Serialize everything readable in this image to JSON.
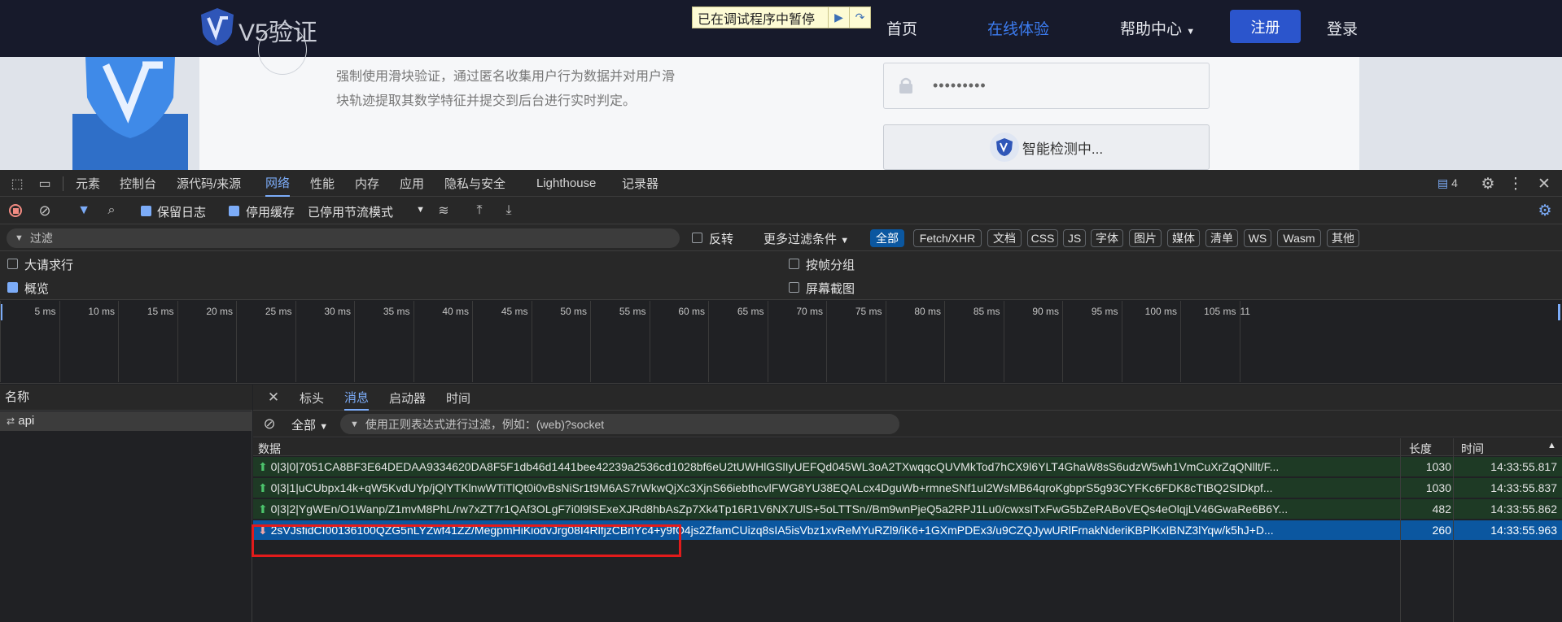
{
  "site": {
    "logo_text": "V5验证",
    "debug_banner": "已在调试程序中暂停",
    "nav": [
      "首页",
      "在线体验",
      "帮助中心",
      "注册",
      "登录"
    ],
    "description": "强制使用滑块验证，通过匿名收集用户行为数据并对用户滑块轨迹提取其数学特征并提交到后台进行实时判定。",
    "password_mask": "•••••••••",
    "detect_label": "智能检测中..."
  },
  "devtools": {
    "tabs": [
      "元素",
      "控制台",
      "源代码/来源",
      "网络",
      "性能",
      "内存",
      "应用",
      "隐私与安全",
      "Lighthouse",
      "记录器"
    ],
    "active_tab": "网络",
    "issues_count": "4",
    "toolbar": {
      "preserve_log": "保留日志",
      "disable_cache": "停用缓存",
      "throttle": "已停用节流模式"
    },
    "filter": {
      "placeholder": "过滤",
      "invert": "反转",
      "more_filters": "更多过滤条件"
    },
    "type_chips": [
      "全部",
      "Fetch/XHR",
      "文档",
      "CSS",
      "JS",
      "字体",
      "图片",
      "媒体",
      "清单",
      "WS",
      "Wasm",
      "其他"
    ],
    "options": {
      "large_rows": "大请求行",
      "overview": "概览",
      "group_by_frame": "按帧分组",
      "screenshots": "屏幕截图"
    },
    "timeline_ticks": [
      "5 ms",
      "10 ms",
      "15 ms",
      "20 ms",
      "25 ms",
      "30 ms",
      "35 ms",
      "40 ms",
      "45 ms",
      "50 ms",
      "55 ms",
      "60 ms",
      "65 ms",
      "70 ms",
      "75 ms",
      "80 ms",
      "85 ms",
      "90 ms",
      "95 ms",
      "100 ms",
      "105 ms",
      "11"
    ],
    "name_header": "名称",
    "request_name": "api",
    "detail_tabs": [
      "标头",
      "消息",
      "启动器",
      "时间"
    ],
    "detail_active": "消息",
    "msg_filter_type": "全部",
    "msg_filter_placeholder": "使用正则表达式进行过滤，例如：(web)?socket",
    "columns": {
      "data": "数据",
      "length": "长度",
      "time": "时间"
    },
    "messages": [
      {
        "dir": "sent",
        "data": "0|3|0|7051CA8BF3E64DEDAA9334620DA8F5F1db46d1441bee42239a2536cd1028bf6eU2tUWHlGSlIyUEFQd045WL3oA2TXwqqcQUVMkTod7hCX9l6YLT4GhaW8sS6udzW5wh1VmCuXrZqQNllt/F...",
        "length": "1030",
        "time": "14:33:55.817"
      },
      {
        "dir": "sent",
        "data": "0|3|1|uCUbpx14k+qW5KvdUYp/jQlYTKlnwWTiTlQt0i0vBsNiSr1t9M6AS7rWkwQjXc3XjnS66iebthcvlFWG8YU38EQALcx4DguWb+rmneSNf1uI2WsMB64qroKgbprS5g93CYFKc6FDK8cTtBQ2SIDkpf...",
        "length": "1030",
        "time": "14:33:55.837"
      },
      {
        "dir": "sent",
        "data": "0|3|2|YgWEn/O1Wanp/Z1mvM8PhL/rw7xZT7r1QAf3OLgF7i0l9lSExeXJRd8hbAsZp7Xk4Tp16R1V6NX7UlS+5oLTTSn//Bm9wnPjeQ5a2RPJ1Lu0/cwxsITxFwG5bZeRABoVEQs4eOlqjLV46GwaRe6B6Y...",
        "length": "482",
        "time": "14:33:55.862"
      },
      {
        "dir": "recv",
        "data": "2sVJsfidCI00136100QZG5nLYZwf41ZZ/MegpmHiKiodvJrg08I4RlfjzCBrlYc4+y9fO4js2ZfamCUizq8sIA5isVbz1xvReMYuRZl9/iK6+1GXmPDEx3/u9CZQJywURlFrnakNderiKBPlKxIBNZ3lYqw/k5hJ+D...",
        "length": "260",
        "time": "14:33:55.963"
      }
    ]
  }
}
